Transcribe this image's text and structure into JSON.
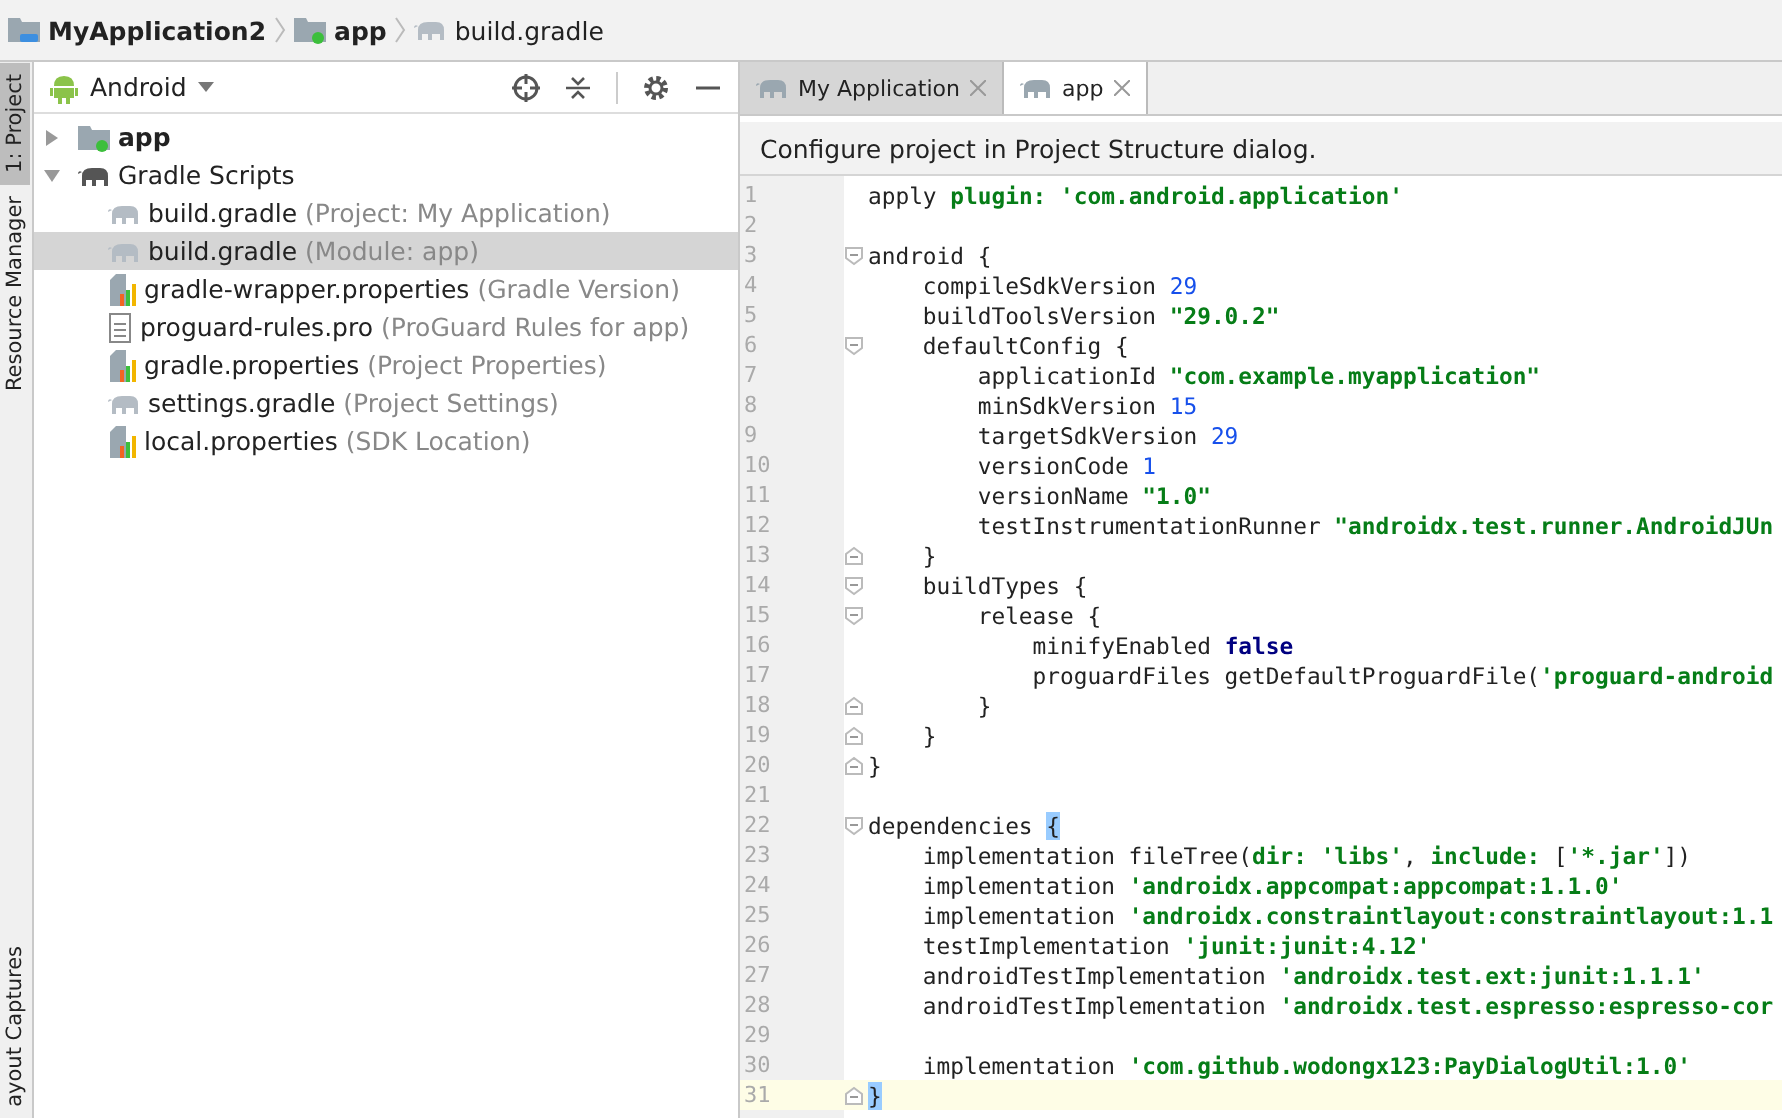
{
  "breadcrumb": [
    {
      "label": "MyApplication2",
      "kind": "project"
    },
    {
      "label": "app",
      "kind": "module"
    },
    {
      "label": "build.gradle",
      "kind": "gradle"
    }
  ],
  "tool_strip": [
    {
      "label": "1: Project",
      "selected": true
    },
    {
      "label": "Resource Manager",
      "selected": false
    },
    {
      "label": "ayout Captures",
      "selected": false
    }
  ],
  "project_panel": {
    "view": "Android",
    "tree": [
      {
        "name": "app",
        "kind": "module",
        "expanded": false,
        "selected": false
      },
      {
        "name": "Gradle Scripts",
        "kind": "group",
        "expanded": true,
        "selected": false,
        "children": [
          {
            "name": "build.gradle",
            "hint": "(Project: My Application)",
            "kind": "gradle",
            "selected": false
          },
          {
            "name": "build.gradle",
            "hint": "(Module: app)",
            "kind": "gradle",
            "selected": true
          },
          {
            "name": "gradle-wrapper.properties",
            "hint": "(Gradle Version)",
            "kind": "properties",
            "selected": false
          },
          {
            "name": "proguard-rules.pro",
            "hint": "(ProGuard Rules for app)",
            "kind": "text",
            "selected": false
          },
          {
            "name": "gradle.properties",
            "hint": "(Project Properties)",
            "kind": "properties",
            "selected": false
          },
          {
            "name": "settings.gradle",
            "hint": "(Project Settings)",
            "kind": "gradle",
            "selected": false
          },
          {
            "name": "local.properties",
            "hint": "(SDK Location)",
            "kind": "properties",
            "selected": false
          }
        ]
      }
    ]
  },
  "editor_tabs": [
    {
      "label": "My Application",
      "selected": false
    },
    {
      "label": "app",
      "selected": true
    }
  ],
  "banner": "Configure project in Project Structure dialog.",
  "code": [
    {
      "number": "1",
      "current": false,
      "kind": "plain",
      "segments": [
        {
          "text": "apply ",
          "kind": "plain"
        },
        {
          "text": "plugin: ",
          "kind": "key"
        },
        {
          "text": "'com.android.application'",
          "kind": "string"
        }
      ]
    },
    {
      "number": "2",
      "current": false,
      "kind": "plain"
    },
    {
      "number": "3",
      "current": false,
      "kind": "opener",
      "segments": [
        {
          "text": "android {",
          "kind": "plain"
        }
      ]
    },
    {
      "number": "4",
      "current": false,
      "kind": "plain",
      "segments": [
        {
          "text": "    compileSdkVersion ",
          "kind": "plain"
        },
        {
          "text": "29",
          "kind": "number"
        }
      ]
    },
    {
      "number": "5",
      "current": false,
      "kind": "plain",
      "segments": [
        {
          "text": "    buildToolsVersion ",
          "kind": "plain"
        },
        {
          "text": "\"29.0.2\"",
          "kind": "string"
        }
      ]
    },
    {
      "number": "6",
      "current": false,
      "kind": "opener",
      "segments": [
        {
          "text": "    defaultConfig {",
          "kind": "plain"
        }
      ]
    },
    {
      "number": "7",
      "current": false,
      "kind": "plain",
      "segments": [
        {
          "text": "        applicationId ",
          "kind": "plain"
        },
        {
          "text": "\"com.example.myapplication\"",
          "kind": "string"
        }
      ]
    },
    {
      "number": "8",
      "current": false,
      "kind": "plain",
      "segments": [
        {
          "text": "        minSdkVersion ",
          "kind": "plain"
        },
        {
          "text": "15",
          "kind": "number"
        }
      ]
    },
    {
      "number": "9",
      "current": false,
      "kind": "plain",
      "segments": [
        {
          "text": "        targetSdkVersion ",
          "kind": "plain"
        },
        {
          "text": "29",
          "kind": "number"
        }
      ]
    },
    {
      "number": "10",
      "current": false,
      "kind": "plain",
      "segments": [
        {
          "text": "        versionCode ",
          "kind": "plain"
        },
        {
          "text": "1",
          "kind": "number"
        }
      ]
    },
    {
      "number": "11",
      "current": false,
      "kind": "plain",
      "segments": [
        {
          "text": "        versionName ",
          "kind": "plain"
        },
        {
          "text": "\"1.0\"",
          "kind": "string"
        }
      ]
    },
    {
      "number": "12",
      "current": false,
      "kind": "plain",
      "segments": [
        {
          "text": "        testInstrumentationRunner ",
          "kind": "plain"
        },
        {
          "text": "\"androidx.test.runner.AndroidJUn",
          "kind": "string"
        }
      ]
    },
    {
      "number": "13",
      "current": false,
      "kind": "closer",
      "segments": [
        {
          "text": "    }",
          "kind": "plain"
        }
      ]
    },
    {
      "number": "14",
      "current": false,
      "kind": "opener",
      "segments": [
        {
          "text": "    buildTypes {",
          "kind": "plain"
        }
      ]
    },
    {
      "number": "15",
      "current": false,
      "kind": "opener",
      "segments": [
        {
          "text": "        release {",
          "kind": "plain"
        }
      ]
    },
    {
      "number": "16",
      "current": false,
      "kind": "plain",
      "segments": [
        {
          "text": "            minifyEnabled ",
          "kind": "plain"
        },
        {
          "text": "false",
          "kind": "bool"
        }
      ]
    },
    {
      "number": "17",
      "current": false,
      "kind": "plain",
      "segments": [
        {
          "text": "            proguardFiles getDefaultProguardFile(",
          "kind": "plain"
        },
        {
          "text": "'proguard-android",
          "kind": "string"
        }
      ]
    },
    {
      "number": "18",
      "current": false,
      "kind": "closer",
      "segments": [
        {
          "text": "        }",
          "kind": "plain"
        }
      ]
    },
    {
      "number": "19",
      "current": false,
      "kind": "closer",
      "segments": [
        {
          "text": "    }",
          "kind": "plain"
        }
      ]
    },
    {
      "number": "20",
      "current": false,
      "kind": "closer",
      "segments": [
        {
          "text": "}",
          "kind": "plain"
        }
      ]
    },
    {
      "number": "21",
      "current": false,
      "kind": "plain"
    },
    {
      "number": "22",
      "current": false,
      "kind": "opener",
      "segments": [
        {
          "text": "dependencies ",
          "kind": "plain"
        },
        {
          "text": "{",
          "kind": "match"
        }
      ]
    },
    {
      "number": "23",
      "current": false,
      "kind": "plain",
      "segments": [
        {
          "text": "    implementation fileTree(",
          "kind": "plain"
        },
        {
          "text": "dir: ",
          "kind": "key"
        },
        {
          "text": "'libs'",
          "kind": "string"
        },
        {
          "text": ", ",
          "kind": "plain"
        },
        {
          "text": "include:",
          "kind": "key"
        },
        {
          "text": " [",
          "kind": "plain"
        },
        {
          "text": "'*.jar'",
          "kind": "string"
        },
        {
          "text": "])",
          "kind": "plain"
        }
      ]
    },
    {
      "number": "24",
      "current": false,
      "kind": "plain",
      "segments": [
        {
          "text": "    implementation ",
          "kind": "plain"
        },
        {
          "text": "'androidx.appcompat:appcompat:1.1.0'",
          "kind": "string"
        }
      ]
    },
    {
      "number": "25",
      "current": false,
      "kind": "plain",
      "segments": [
        {
          "text": "    implementation ",
          "kind": "plain"
        },
        {
          "text": "'androidx.constraintlayout:constraintlayout:1.1",
          "kind": "string"
        }
      ]
    },
    {
      "number": "26",
      "current": false,
      "kind": "plain",
      "segments": [
        {
          "text": "    testImplementation ",
          "kind": "plain"
        },
        {
          "text": "'junit:junit:4.12'",
          "kind": "string"
        }
      ]
    },
    {
      "number": "27",
      "current": false,
      "kind": "plain",
      "segments": [
        {
          "text": "    androidTestImplementation ",
          "kind": "plain"
        },
        {
          "text": "'androidx.test.ext:junit:1.1.1'",
          "kind": "string"
        }
      ]
    },
    {
      "number": "28",
      "current": false,
      "kind": "plain",
      "segments": [
        {
          "text": "    androidTestImplementation ",
          "kind": "plain"
        },
        {
          "text": "'androidx.test.espresso:espresso-cor",
          "kind": "string"
        }
      ]
    },
    {
      "number": "29",
      "current": false,
      "kind": "plain"
    },
    {
      "number": "30",
      "current": false,
      "kind": "plain",
      "segments": [
        {
          "text": "    implementation ",
          "kind": "plain"
        },
        {
          "text": "'com.github.wodongx123:PayDialogUtil:1.0'",
          "kind": "string"
        }
      ]
    },
    {
      "number": "31",
      "current": true,
      "kind": "closer",
      "segments": [
        {
          "text": "}",
          "kind": "match"
        }
      ]
    }
  ]
}
